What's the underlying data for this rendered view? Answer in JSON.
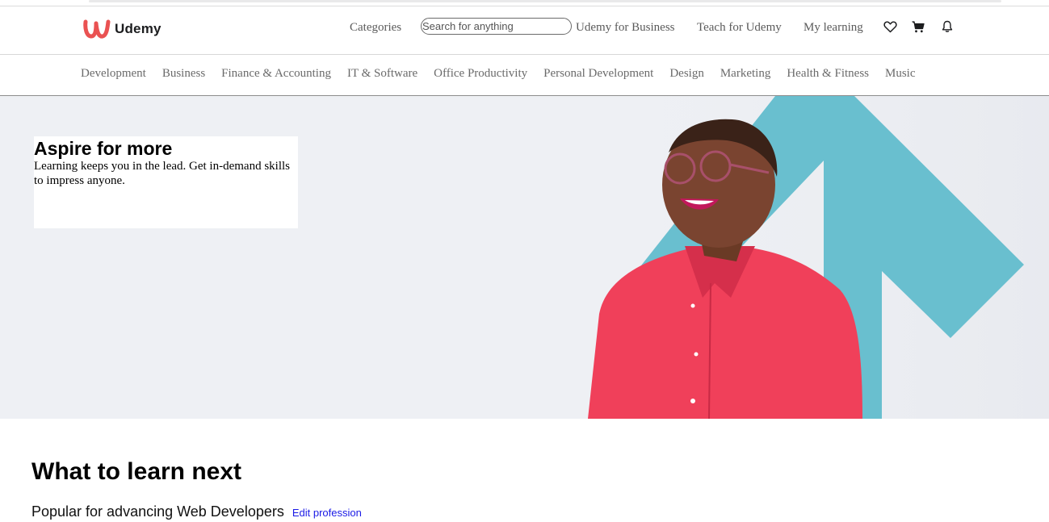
{
  "brand": {
    "name": "Udemy",
    "logo_icon": "udemy-u-logo",
    "logo_color": "#ea5252"
  },
  "header": {
    "categories_label": "Categories",
    "search": {
      "placeholder": "Search for anything",
      "value": ""
    },
    "links": [
      "Udemy for Business",
      "Teach for Udemy",
      "My learning"
    ],
    "icons": [
      "heart-icon",
      "cart-icon",
      "bell-icon"
    ]
  },
  "category_nav": [
    "Development",
    "Business",
    "Finance & Accounting",
    "IT & Software",
    "Office Productivity",
    "Personal Development",
    "Design",
    "Marketing",
    "Health & Fitness",
    "Music"
  ],
  "hero": {
    "title": "Aspire for more",
    "subtitle": "Learning keeps you in the lead. Get in-demand skills to impress anyone.",
    "background_color": "#eef0f4",
    "accent_color": "#69bfcf",
    "shirt_color": "#f0405a"
  },
  "section": {
    "title": "What to learn next",
    "subtitle": "Popular for advancing Web Developers",
    "edit_link": "Edit profession",
    "link_color": "#1a1ae6"
  }
}
